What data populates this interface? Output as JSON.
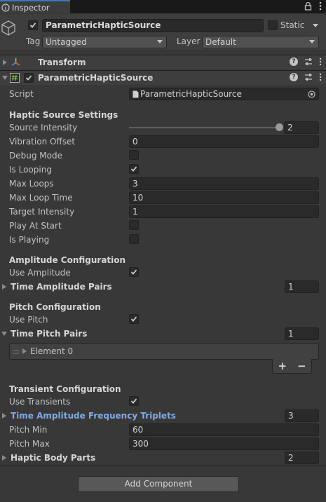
{
  "tab": {
    "label": "Inspector"
  },
  "gameobject": {
    "active": true,
    "name": "ParametricHapticSource",
    "static_label": "Static",
    "tag_label": "Tag",
    "tag_value": "Untagged",
    "layer_label": "Layer",
    "layer_value": "Default"
  },
  "components": {
    "transform": {
      "title": "Transform"
    },
    "script_comp": {
      "title": "ParametricHapticSource",
      "enabled": true
    }
  },
  "script": {
    "label": "Script",
    "value": "ParametricHapticSource"
  },
  "haptic_settings": {
    "header": "Haptic Source Settings",
    "source_intensity": {
      "label": "Source Intensity",
      "value": "2",
      "slider_fraction": 1.0
    },
    "vibration_offset": {
      "label": "Vibration Offset",
      "value": "0"
    },
    "debug_mode": {
      "label": "Debug Mode",
      "checked": false
    },
    "is_looping": {
      "label": "Is Looping",
      "checked": true
    },
    "max_loops": {
      "label": "Max Loops",
      "value": "3"
    },
    "max_loop_time": {
      "label": "Max Loop Time",
      "value": "10"
    },
    "target_intensity": {
      "label": "Target Intensity",
      "value": "1"
    },
    "play_at_start": {
      "label": "Play At Start",
      "checked": false
    },
    "is_playing": {
      "label": "Is Playing",
      "checked": false
    }
  },
  "amplitude": {
    "header": "Amplitude Configuration",
    "use_amplitude": {
      "label": "Use Amplitude",
      "checked": true
    },
    "pairs": {
      "label": "Time Amplitude Pairs",
      "count": "1"
    }
  },
  "pitch": {
    "header": "Pitch Configuration",
    "use_pitch": {
      "label": "Use Pitch",
      "checked": true
    },
    "pairs": {
      "label": "Time Pitch Pairs",
      "count": "1"
    },
    "elements": [
      {
        "label": "Element 0"
      }
    ],
    "add_label": "+",
    "remove_label": "−"
  },
  "transient": {
    "header": "Transient Configuration",
    "use_transients": {
      "label": "Use Transients",
      "checked": true
    },
    "triplets": {
      "label": "Time Amplitude Frequency Triplets",
      "count": "3"
    },
    "pitch_min": {
      "label": "Pitch Min",
      "value": "60"
    },
    "pitch_max": {
      "label": "Pitch Max",
      "value": "300"
    },
    "body_parts": {
      "label": "Haptic Body Parts",
      "count": "2"
    }
  },
  "add_component": {
    "label": "Add Component"
  },
  "colors": {
    "accent_blue": "#84a9e5",
    "tab_highlight": "#3a79bb",
    "background": "#383838"
  }
}
